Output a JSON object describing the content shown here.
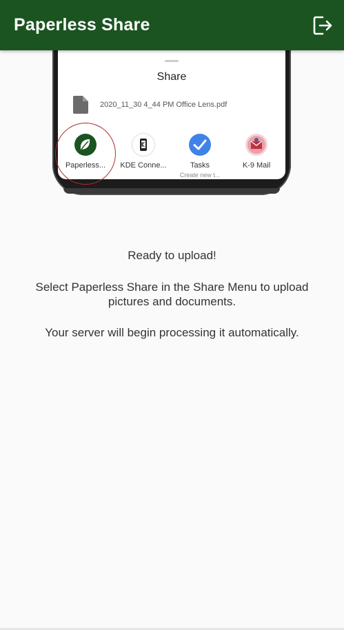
{
  "appbar": {
    "title": "Paperless Share",
    "logout_icon": "logout-icon",
    "background_color": "#1b5420"
  },
  "share_sheet": {
    "title": "Share",
    "file_name": "2020_11_30 4_44 PM Office Lens.pdf",
    "file_icon": "document-icon",
    "apps": [
      {
        "label": "Paperless...",
        "icon": "leaf-icon",
        "color": "#1b5420"
      },
      {
        "label": "KDE Conne...",
        "icon": "kde-connect-icon",
        "color": "#ffffff"
      },
      {
        "label": "Tasks",
        "sublabel": "Create new t...",
        "icon": "checkmark-icon",
        "color": "#3f82e8"
      },
      {
        "label": "K-9 Mail",
        "icon": "k9-mail-icon",
        "color": "#e9a0a8"
      }
    ]
  },
  "messages": {
    "ready": "Ready to upload!",
    "instruction": "Select Paperless Share in the Share Menu to upload pictures and documents.",
    "processing": "Your server will begin processing it automatically."
  }
}
